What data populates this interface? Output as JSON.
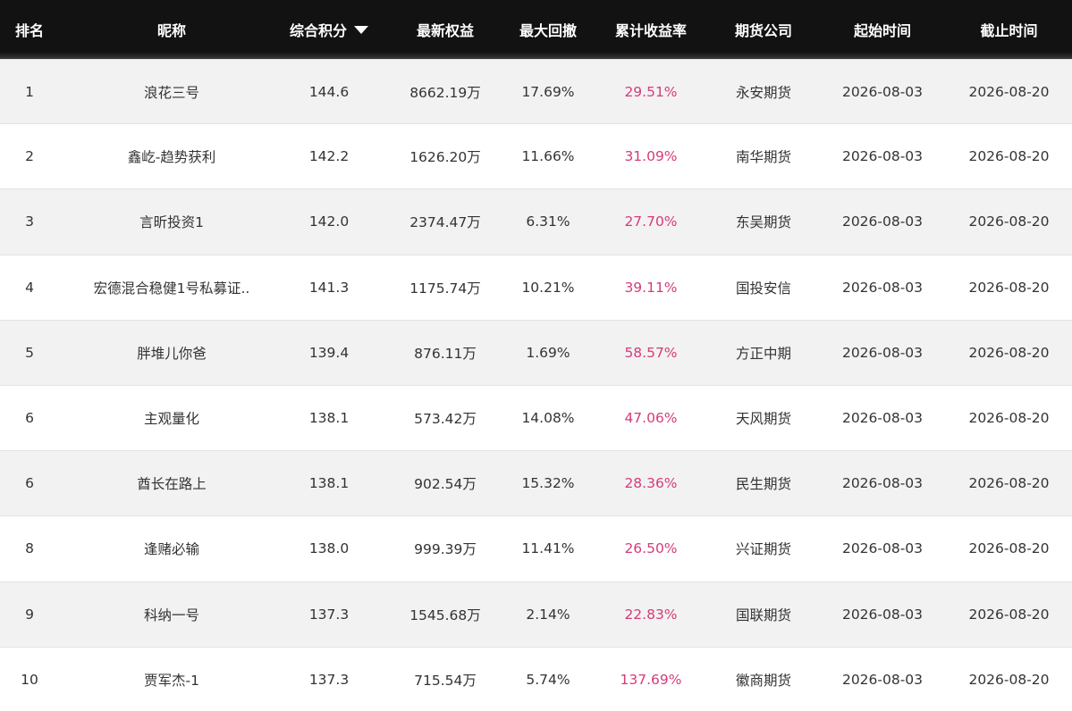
{
  "header": {
    "rank": "排名",
    "nickname": "昵称",
    "score": "综合积分",
    "equity": "最新权益",
    "max_drawdown": "最大回撤",
    "cumulative_return": "累计收益率",
    "broker": "期货公司",
    "start_date": "起始时间",
    "end_date": "截止时间"
  },
  "rows": [
    {
      "rank": "1",
      "nickname": "浪花三号",
      "score": "144.6",
      "equity": "8662.19万",
      "max_drawdown": "17.69%",
      "cumulative_return": "29.51%",
      "broker": "永安期货",
      "start_date": "2026-08-03",
      "end_date": "2026-08-20"
    },
    {
      "rank": "2",
      "nickname": "鑫屹-趋势获利",
      "score": "142.2",
      "equity": "1626.20万",
      "max_drawdown": "11.66%",
      "cumulative_return": "31.09%",
      "broker": "南华期货",
      "start_date": "2026-08-03",
      "end_date": "2026-08-20"
    },
    {
      "rank": "3",
      "nickname": "言昕投资1",
      "score": "142.0",
      "equity": "2374.47万",
      "max_drawdown": "6.31%",
      "cumulative_return": "27.70%",
      "broker": "东吴期货",
      "start_date": "2026-08-03",
      "end_date": "2026-08-20"
    },
    {
      "rank": "4",
      "nickname": "宏德混合稳健1号私募证..",
      "score": "141.3",
      "equity": "1175.74万",
      "max_drawdown": "10.21%",
      "cumulative_return": "39.11%",
      "broker": "国投安信",
      "start_date": "2026-08-03",
      "end_date": "2026-08-20"
    },
    {
      "rank": "5",
      "nickname": "胖堆儿你爸",
      "score": "139.4",
      "equity": "876.11万",
      "max_drawdown": "1.69%",
      "cumulative_return": "58.57%",
      "broker": "方正中期",
      "start_date": "2026-08-03",
      "end_date": "2026-08-20"
    },
    {
      "rank": "6",
      "nickname": "主观量化",
      "score": "138.1",
      "equity": "573.42万",
      "max_drawdown": "14.08%",
      "cumulative_return": "47.06%",
      "broker": "天风期货",
      "start_date": "2026-08-03",
      "end_date": "2026-08-20"
    },
    {
      "rank": "6",
      "nickname": "酋长在路上",
      "score": "138.1",
      "equity": "902.54万",
      "max_drawdown": "15.32%",
      "cumulative_return": "28.36%",
      "broker": "民生期货",
      "start_date": "2026-08-03",
      "end_date": "2026-08-20"
    },
    {
      "rank": "8",
      "nickname": "逢赌必输",
      "score": "138.0",
      "equity": "999.39万",
      "max_drawdown": "11.41%",
      "cumulative_return": "26.50%",
      "broker": "兴证期货",
      "start_date": "2026-08-03",
      "end_date": "2026-08-20"
    },
    {
      "rank": "9",
      "nickname": "科纳一号",
      "score": "137.3",
      "equity": "1545.68万",
      "max_drawdown": "2.14%",
      "cumulative_return": "22.83%",
      "broker": "国联期货",
      "start_date": "2026-08-03",
      "end_date": "2026-08-20"
    },
    {
      "rank": "10",
      "nickname": "贾军杰-1",
      "score": "137.3",
      "equity": "715.54万",
      "max_drawdown": "5.74%",
      "cumulative_return": "137.69%",
      "broker": "徽商期货",
      "start_date": "2026-08-03",
      "end_date": "2026-08-20"
    }
  ],
  "colors": {
    "header_bg": "#121212",
    "return_text": "#d63b7a",
    "row_alt": "#f2f2f2"
  },
  "icons": {
    "sort": "caret-down-icon"
  }
}
